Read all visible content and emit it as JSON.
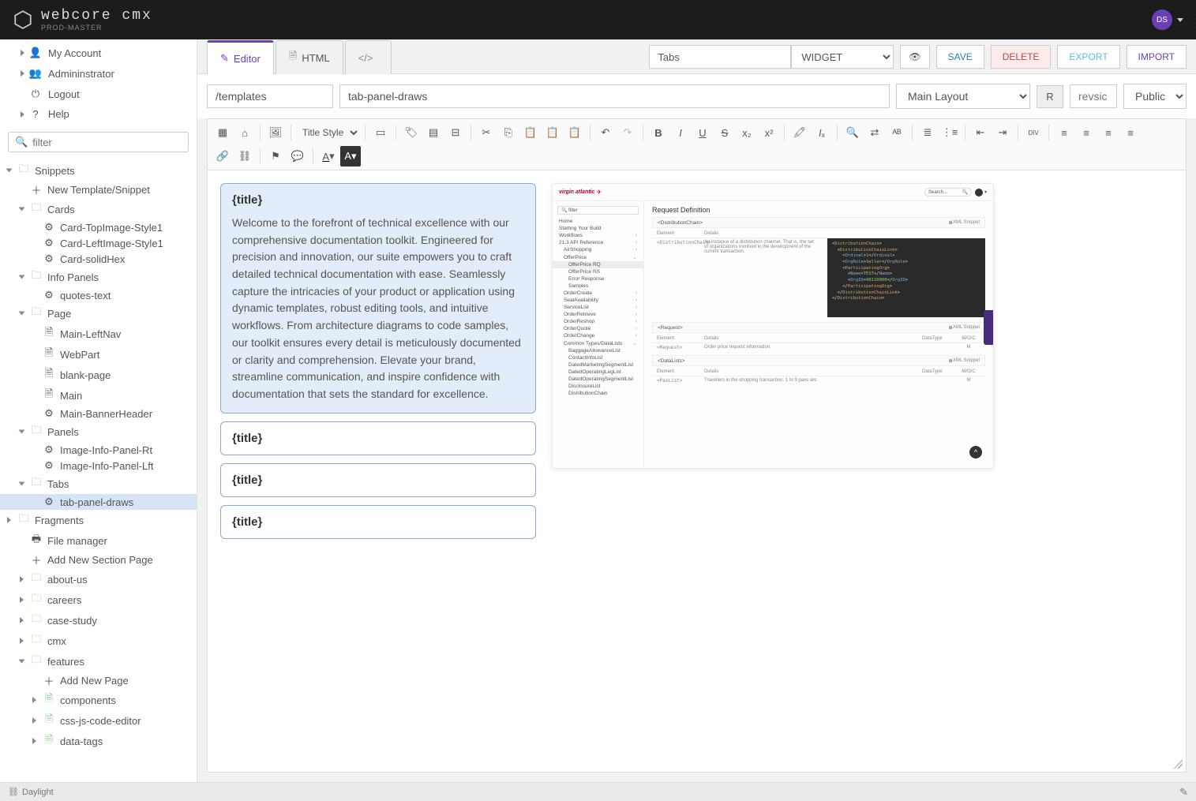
{
  "brand": {
    "title": "webcore cmx",
    "sub": "PROD-MASTER"
  },
  "avatar": "DS",
  "usermenu": {
    "account": "My Account",
    "admin": "Admininstrator",
    "logout": "Logout",
    "help": "Help"
  },
  "filter_placeholder": "filter",
  "tree": {
    "snippets": "Snippets",
    "new_template": "New Template/Snippet",
    "cards": "Cards",
    "card_top": "Card-TopImage-Style1",
    "card_left": "Card-LeftImage-Style1",
    "card_hex": "Card-solidHex",
    "info_panels": "Info Panels",
    "quotes": "quotes-text",
    "page": "Page",
    "main_left": "Main-LeftNav",
    "webpart": "WebPart",
    "blank": "blank-page",
    "main": "Main",
    "main_banner": "Main-BannerHeader",
    "panels": "Panels",
    "img_rt": "Image-Info-Panel-Rt",
    "img_lft": "Image-Info-Panel-Lft",
    "tabs": "Tabs",
    "tab_panel": "tab-panel-draws",
    "fragments": "Fragments",
    "filemgr": "File manager",
    "add_section": "Add New Section Page",
    "about": "about-us",
    "careers": "careers",
    "case": "case-study",
    "cmx": "cmx",
    "features": "features",
    "add_page": "Add New Page",
    "components": "components",
    "css_js": "css-js-code-editor",
    "data_tags": "data-tags"
  },
  "doctabs": {
    "editor": "Editor",
    "html": "HTML"
  },
  "topfields": {
    "tabs": "Tabs",
    "widget": "WIDGET",
    "save": "SAVE",
    "delete": "DELETE",
    "export": "EXPORT",
    "import": "IMPORT"
  },
  "meta": {
    "path": "/templates",
    "name": "tab-panel-draws",
    "layout": "Main Layout",
    "r": "R",
    "rev": "revsic",
    "vis": "Public"
  },
  "toolbar_title_style": "Title Style",
  "panel": {
    "title": "{title}",
    "body": "Welcome to the forefront of technical excellence with our comprehensive documentation toolkit. Engineered for precision and innovation, our suite empowers you to craft detailed technical documentation with ease. Seamlessly capture the intricacies of your product or application using dynamic templates, robust editing tools, and intuitive workflows. From architecture diagrams to code samples, our toolkit ensures every detail is meticulously documented or clarity and comprehension. Elevate your brand, streamline communication, and inspire confidence with documentation that sets the standard for excellence."
  },
  "preview": {
    "logo": "virgin atlantic",
    "search": "Search...",
    "filter": "filter",
    "nav": {
      "home": "Home",
      "starting": "Starting Your Build",
      "workflows": "Workflows",
      "api": "21.3 API Reference",
      "airshopping": "AirShopping",
      "offerprice": "OfferPrice",
      "offerprice_rq": "OfferPrice RQ",
      "offerprice_rs": "OfferPrice RS",
      "error": "Error Response",
      "samples": "Samples",
      "ordercreate": "OrderCreate",
      "seatavail": "SeatAvailability",
      "servicelist": "ServiceList",
      "orderretrieve": "OrderRetrieve",
      "orderreshop": "OrderReshop",
      "orderquote": "OrderQuote",
      "orderchange": "OrderChange",
      "common": "Common Types/DataLists",
      "baggage": "BaggageAllowanceList",
      "contact": "ContactInfoList",
      "dms": "DatedMarketingSegmentList",
      "dol": "DatedOperatingLegList",
      "dosl": "DatedOperatingSegmentList",
      "disclosure": "DisclosureList",
      "distchain": "DistributionChain"
    },
    "heading": "Request Definition",
    "dist_chain": "<DistributionChain>",
    "xml_snippet": "XML Snippet",
    "element": "Element",
    "details": "Details",
    "datatype": "DataType",
    "moc": "M/O/C",
    "dist_desc": "An instance of a distribution channel. That is, the set of organizations involved in the development of the current transaction.",
    "dist_el": "<DistributionChain>",
    "request": "<Request>",
    "req_el": "<Request>",
    "req_desc": "Order price request information.",
    "m": "M",
    "datalists": "<DataLists>",
    "paxlist_el": "<PaxList>",
    "paxlist_desc": "Travellers in the shopping transaction. 1 to 9 paxs are"
  },
  "footer": {
    "daylight": "Daylight"
  }
}
